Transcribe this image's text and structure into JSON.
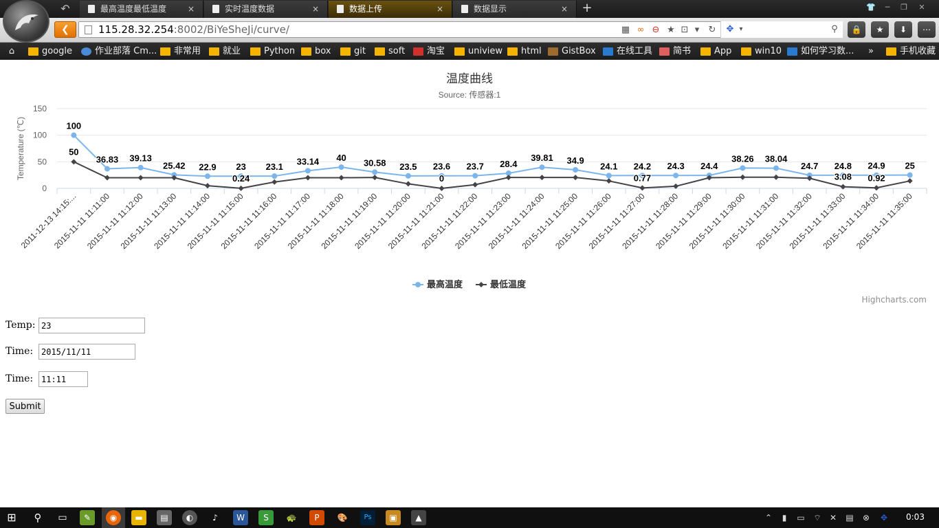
{
  "browser": {
    "tabs": [
      {
        "label": "最高温度最低温度",
        "active": false
      },
      {
        "label": "实时温度数据",
        "active": false
      },
      {
        "label": "数据上传",
        "active": true
      },
      {
        "label": "数据显示",
        "active": false
      }
    ],
    "tab_close": "×",
    "new_tab": "+",
    "url_host": "115.28.32.254",
    "url_rest": ":8002/BiYeSheJi/curve/",
    "bookmarks": [
      "google",
      "作业部落 Cm...",
      "非常用",
      "就业",
      "Python",
      "box",
      "git",
      "soft",
      "淘宝",
      "uniview",
      "html",
      "GistBox",
      "在线工具",
      "简书",
      "App",
      "win10",
      "如何学习数...",
      "手机收藏"
    ],
    "bookmarks_more": "»"
  },
  "chart_data": {
    "type": "line",
    "title": "温度曲线",
    "subtitle": "Source: 传感器:1",
    "ylabel": "Temperature (℃)",
    "ylim": [
      0,
      150
    ],
    "yticks": [
      0,
      50,
      100,
      150
    ],
    "categories": [
      "2011-12-13 14:15:...",
      "2015-11-11 11:11:00",
      "2015-11-11 11:12:00",
      "2015-11-11 11:13:00",
      "2015-11-11 11:14:00",
      "2015-11-11 11:15:00",
      "2015-11-11 11:16:00",
      "2015-11-11 11:17:00",
      "2015-11-11 11:18:00",
      "2015-11-11 11:19:00",
      "2015-11-11 11:20:00",
      "2015-11-11 11:21:00",
      "2015-11-11 11:22:00",
      "2015-11-11 11:23:00",
      "2015-11-11 11:24:00",
      "2015-11-11 11:25:00",
      "2015-11-11 11:26:00",
      "2015-11-11 11:27:00",
      "2015-11-11 11:28:00",
      "2015-11-11 11:29:00",
      "2015-11-11 11:30:00",
      "2015-11-11 11:31:00",
      "2015-11-11 11:32:00",
      "2015-11-11 11:33:00",
      "2015-11-11 11:34:00",
      "2015-11-11 11:35:00"
    ],
    "series": [
      {
        "name": "最高温度",
        "color": "#7cb5ec",
        "marker": "circle",
        "values": [
          100,
          36.83,
          39.13,
          25.42,
          22.9,
          23,
          23.1,
          33.14,
          40,
          30.58,
          23.5,
          23.6,
          23.7,
          28.4,
          39.81,
          34.9,
          24.1,
          24.2,
          24.3,
          24.4,
          38.26,
          38.04,
          24.7,
          24.8,
          24.9,
          25
        ]
      },
      {
        "name": "最低温度",
        "color": "#434348",
        "marker": "diamond",
        "values": [
          50,
          20,
          20,
          20,
          5,
          0.24,
          12,
          20,
          20,
          20.5,
          8.5,
          0,
          7,
          20.5,
          20.5,
          20.5,
          14,
          0.77,
          4,
          20,
          21,
          21,
          19,
          3.08,
          0.92,
          14
        ],
        "labeled": {
          "0": 50,
          "5": 0.24,
          "11": 0,
          "17": 0.77,
          "23": 3.08,
          "24": 0.92
        }
      }
    ],
    "legend": "bottom-center",
    "grid": true,
    "credits": "Highcharts.com"
  },
  "form": {
    "temp_label": "Temp:",
    "temp_value": "23",
    "date_label": "Time:",
    "date_value": "2015/11/11",
    "time_label": "Time:",
    "time_value": "11:11",
    "submit_label": "Submit"
  },
  "taskbar": {
    "clock": "0:03"
  }
}
